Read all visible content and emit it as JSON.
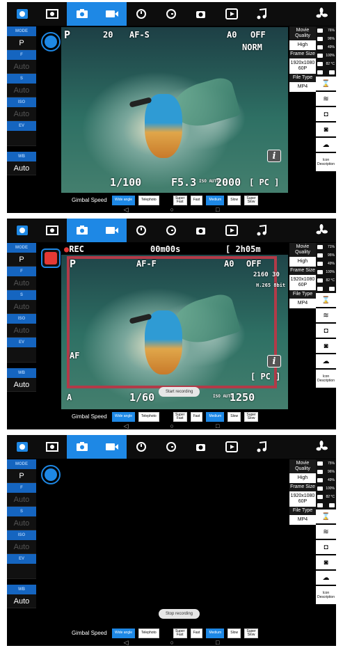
{
  "toolbar": [
    {
      "icon": "camera-info-icon"
    },
    {
      "icon": "live-view-icon"
    },
    {
      "icon": "photo-mode-icon",
      "active": true
    },
    {
      "icon": "movie-mode-icon",
      "active": true
    },
    {
      "icon": "timer-icon"
    },
    {
      "icon": "interval-timer-icon"
    },
    {
      "icon": "remote-shutter-icon"
    },
    {
      "icon": "playback-icon"
    },
    {
      "icon": "music-icon"
    },
    {
      "icon": "moon-icon"
    },
    {
      "icon": "fan-icon"
    }
  ],
  "left_panel": [
    {
      "header": "MODE",
      "value": "P"
    },
    {
      "header": "F",
      "value": "Auto"
    },
    {
      "header": "S",
      "value": "Auto"
    },
    {
      "header": "ISO",
      "value": "Auto"
    },
    {
      "header": "EV",
      "value": ""
    },
    {
      "header": "WB",
      "value": "Auto"
    }
  ],
  "movie_panel": {
    "quality_header": "Movie Quality",
    "quality_value": "High",
    "size_header": "Frame Size",
    "size_value": "1920x1080 60P",
    "type_header": "File Type",
    "type_value": "MP4"
  },
  "status_panels": [
    {
      "signal": "76%",
      "battery": "96%",
      "storage": "49%",
      "cloud": "100%",
      "temp": "82 °C"
    },
    {
      "signal": "71%",
      "battery": "95%",
      "storage": "49%",
      "cloud": "100%",
      "temp": "82 °C"
    },
    {
      "signal": "75%",
      "battery": "96%",
      "storage": "49%",
      "cloud": "100%",
      "temp": "82 °C"
    }
  ],
  "icon_description_label": "Icon Description",
  "gimbal": {
    "label": "Gimbal Speed",
    "buttons": [
      {
        "label": "Wide angle",
        "active": true
      },
      {
        "label": "Telephoto",
        "active": false
      },
      {
        "label": "Super Fast",
        "active": false
      },
      {
        "label": "Fast",
        "active": false
      },
      {
        "label": "Medium",
        "active": true
      },
      {
        "label": "Slow",
        "active": false
      },
      {
        "label": "Super Slow",
        "active": false
      }
    ]
  },
  "hud1": {
    "mode": "P",
    "burst": "20",
    "af": "AF-S",
    "wb": "A0",
    "picctl": "OFF",
    "quality": "NORM",
    "shutter": "1/100",
    "aperture": "F5.3",
    "iso_label": "ISO AUTO",
    "iso": "2000",
    "remaining": "[ PC ]"
  },
  "hud2": {
    "rec": "REC",
    "time": "00m00s",
    "remaining_time": "[ 2h05m",
    "mode": "P",
    "af": "AF-F",
    "wb": "A0",
    "picctl": "OFF",
    "frame": "2160 30",
    "codec": "H.265 8bit",
    "af_mode": "AF",
    "shutter": "1/60",
    "iso_label": "ISO AUTO",
    "iso": "1250",
    "remaining": "[ PC ]",
    "audio_label": "A",
    "toast": "Start recording"
  },
  "hud3": {
    "toast": "Stop recording"
  }
}
